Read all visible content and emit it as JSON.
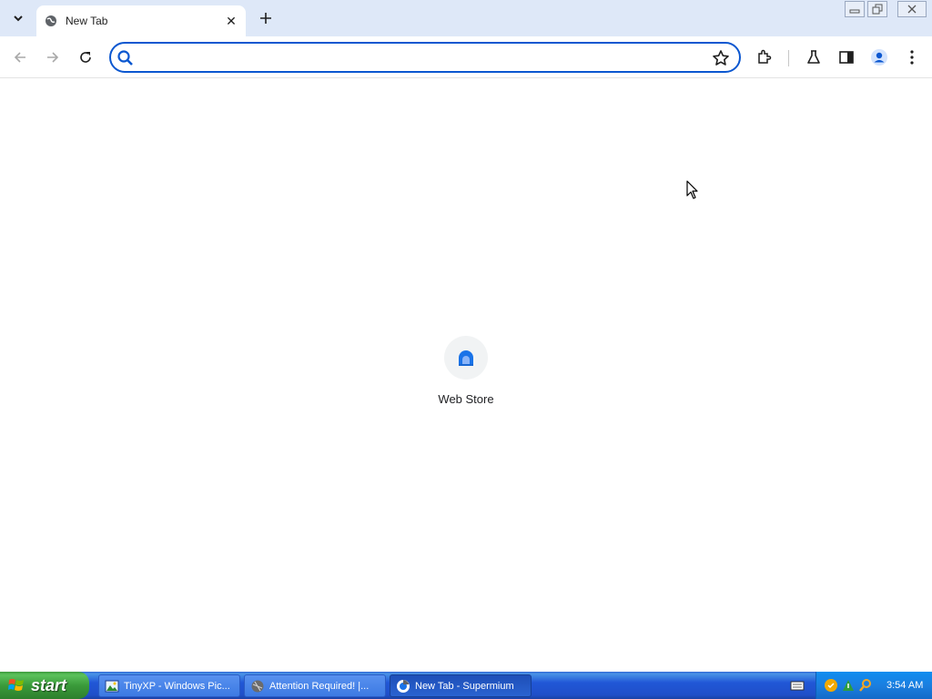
{
  "browser": {
    "tab": {
      "title": "New Tab"
    },
    "omnibox": {
      "value": "",
      "placeholder": ""
    }
  },
  "content": {
    "shortcuts": [
      {
        "label": "Web Store"
      }
    ]
  },
  "taskbar": {
    "start_label": "start",
    "tasks": [
      {
        "label": "TinyXP - Windows Pic...",
        "active": false
      },
      {
        "label": "Attention Required! |...",
        "active": false
      },
      {
        "label": "New Tab - Supermium",
        "active": true
      }
    ],
    "clock": "3:54 AM"
  },
  "colors": {
    "accent": "#0b57d0",
    "tabstrip": "#dee8f8",
    "taskbar": "#2157d7",
    "start": "#3a9b3a"
  }
}
